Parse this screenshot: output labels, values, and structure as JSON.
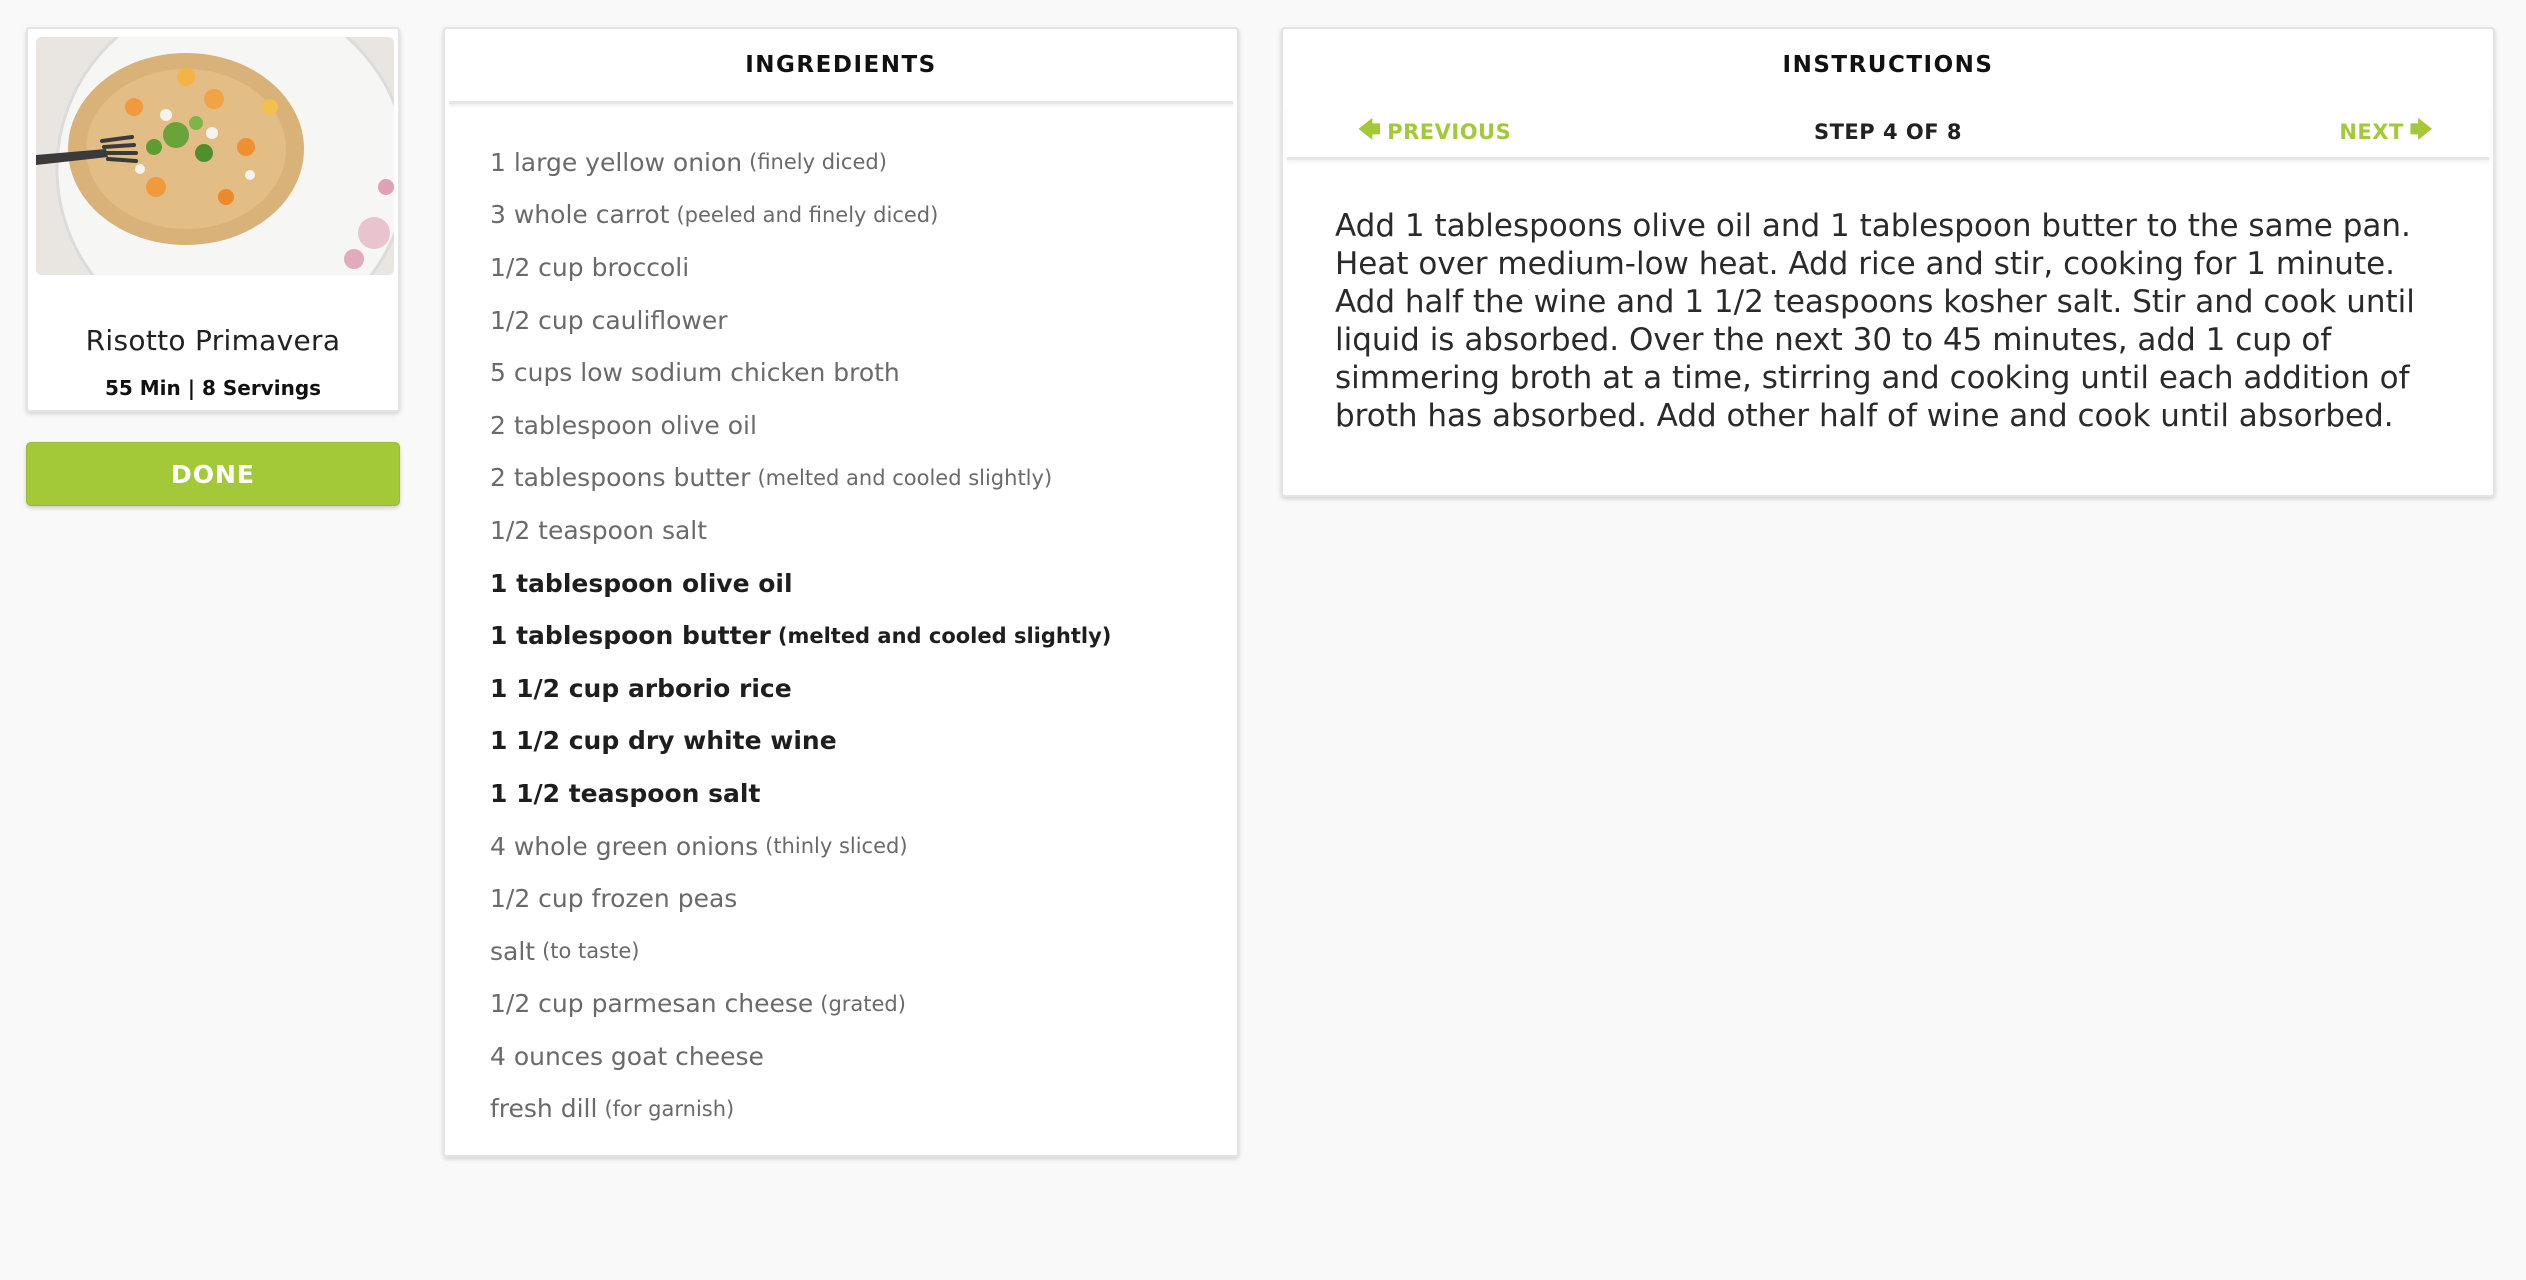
{
  "recipe": {
    "title": "Risotto Primavera",
    "meta": "55 Min | 8 Servings",
    "done_label": "DONE"
  },
  "ingredients": {
    "header": "INGREDIENTS",
    "items": [
      {
        "text": "1 large yellow onion",
        "note": "(finely diced)",
        "active": false
      },
      {
        "text": "3 whole carrot",
        "note": "(peeled and finely diced)",
        "active": false
      },
      {
        "text": "1/2 cup broccoli",
        "note": "",
        "active": false
      },
      {
        "text": "1/2 cup cauliflower",
        "note": "",
        "active": false
      },
      {
        "text": "5 cups low sodium chicken broth",
        "note": "",
        "active": false
      },
      {
        "text": "2 tablespoon olive oil",
        "note": "",
        "active": false
      },
      {
        "text": "2 tablespoons butter",
        "note": "(melted and cooled slightly)",
        "active": false
      },
      {
        "text": "1/2 teaspoon salt",
        "note": "",
        "active": false
      },
      {
        "text": "1 tablespoon olive oil",
        "note": "",
        "active": true
      },
      {
        "text": "1 tablespoon butter",
        "note": "(melted and cooled slightly)",
        "active": true
      },
      {
        "text": "1 1/2 cup arborio rice",
        "note": "",
        "active": true
      },
      {
        "text": "1 1/2 cup dry white wine",
        "note": "",
        "active": true
      },
      {
        "text": "1 1/2 teaspoon salt",
        "note": "",
        "active": true
      },
      {
        "text": "4 whole green onions",
        "note": "(thinly sliced)",
        "active": false
      },
      {
        "text": "1/2 cup frozen peas",
        "note": "",
        "active": false
      },
      {
        "text": "salt",
        "note": "(to taste)",
        "active": false
      },
      {
        "text": "1/2 cup parmesan cheese",
        "note": "(grated)",
        "active": false
      },
      {
        "text": "4 ounces goat cheese",
        "note": "",
        "active": false
      },
      {
        "text": "fresh dill",
        "note": "(for garnish)",
        "active": false
      }
    ]
  },
  "instructions": {
    "header": "INSTRUCTIONS",
    "previous_label": "PREVIOUS",
    "next_label": "NEXT",
    "step_label": "STEP 4 OF 8",
    "current_step": 4,
    "total_steps": 8,
    "text": "Add 1 tablespoons olive oil and 1 tablespoon butter to the same pan. Heat over medium-low heat. Add rice and stir, cooking for 1 minute. Add half the wine and 1 1/2 teaspoons kosher salt. Stir and cook until liquid is absorbed. Over the next 30 to 45 minutes, add 1 cup of simmering broth at a time, stirring and cooking until each addition of broth has absorbed. Add other half of wine and cook until absorbed."
  },
  "icons": {
    "previous": "arrow-left-icon",
    "next": "arrow-right-icon"
  },
  "colors": {
    "accent": "#a3c838",
    "background": "#f9f9f9",
    "card": "#ffffff",
    "inactive_text": "#6a6a6a",
    "active_text": "#1e1e1e"
  }
}
